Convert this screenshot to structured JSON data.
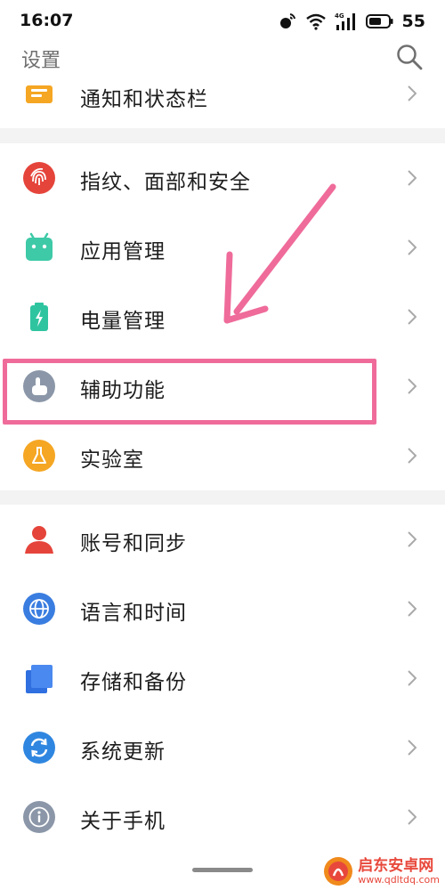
{
  "status_bar": {
    "time": "16:07",
    "network_type": "4G",
    "battery": "55"
  },
  "header": {
    "title": "设置"
  },
  "partial_item": {
    "label": "通知和状态栏",
    "icon": "notification-icon",
    "color": "#f5a623"
  },
  "groups": [
    {
      "items": [
        {
          "label": "指纹、面部和安全",
          "icon": "fingerprint-icon",
          "color": "#e5443b"
        },
        {
          "label": "应用管理",
          "icon": "android-icon",
          "color": "#3ec9a7"
        },
        {
          "label": "电量管理",
          "icon": "battery-icon",
          "color": "#2fc4a0"
        },
        {
          "label": "辅助功能",
          "icon": "hand-icon",
          "color": "#8b97a8"
        },
        {
          "label": "实验室",
          "icon": "flask-icon",
          "color": "#f5a623"
        }
      ]
    },
    {
      "items": [
        {
          "label": "账号和同步",
          "icon": "account-icon",
          "color": "#e5443b"
        },
        {
          "label": "语言和时间",
          "icon": "globe-icon",
          "color": "#3a7de0"
        },
        {
          "label": "存储和备份",
          "icon": "storage-icon",
          "color": "#2f6fe0"
        },
        {
          "label": "系统更新",
          "icon": "update-icon",
          "color": "#2f86e0"
        },
        {
          "label": "关于手机",
          "icon": "info-icon",
          "color": "#8b97a8"
        }
      ]
    }
  ],
  "annotation": {
    "color": "#ef6b9a",
    "highlighted_item": "辅助功能"
  },
  "watermark": {
    "name": "启东安卓网",
    "url": "www.qdltdq.com"
  }
}
